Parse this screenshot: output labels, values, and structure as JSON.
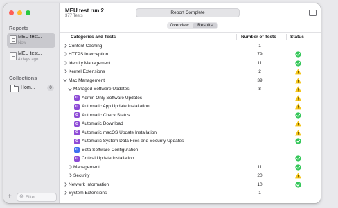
{
  "window": {
    "title": "MEU test run 2",
    "subtitle": "377 Tests",
    "status_pill": "Report Complete"
  },
  "sidebar": {
    "reports_header": "Reports",
    "reports": [
      {
        "name": "MEU test...",
        "sub": "Now",
        "icon": "report-icon",
        "selected": true
      },
      {
        "name": "MEU test...",
        "sub": "4 days ago",
        "icon": "report-icon",
        "selected": false
      }
    ],
    "collections_header": "Collections",
    "collections": [
      {
        "name": "Hom...",
        "count": "0",
        "icon": "folder-icon"
      }
    ],
    "filter_placeholder": "Filter",
    "add_icon": "plus-icon",
    "filter_icon": "filter-icon"
  },
  "tabs": {
    "overview": "Overview",
    "results": "Results",
    "selected": "results"
  },
  "table": {
    "headers": {
      "name": "Categories and Tests",
      "count": "Number of Tests",
      "status": "Status"
    },
    "rows": [
      {
        "label": "Content Caching",
        "count": "1",
        "status": "",
        "level": 0,
        "expandable": true,
        "expanded": false,
        "icon": ""
      },
      {
        "label": "HTTPS Interception",
        "count": "79",
        "status": "pass",
        "level": 0,
        "expandable": true,
        "expanded": false,
        "icon": ""
      },
      {
        "label": "Identity Management",
        "count": "11",
        "status": "pass",
        "level": 0,
        "expandable": true,
        "expanded": false,
        "icon": ""
      },
      {
        "label": "Kernel Extensions",
        "count": "2",
        "status": "warning",
        "level": 0,
        "expandable": true,
        "expanded": false,
        "icon": ""
      },
      {
        "label": "Mac Management",
        "count": "39",
        "status": "warning",
        "level": 0,
        "expandable": true,
        "expanded": true,
        "icon": ""
      },
      {
        "label": "Managed Software Updates",
        "count": "8",
        "status": "warning",
        "level": 1,
        "expandable": true,
        "expanded": true,
        "icon": ""
      },
      {
        "label": "Admin Only Software Updates",
        "count": "",
        "status": "warning",
        "level": 2,
        "expandable": false,
        "expanded": false,
        "icon": "purple"
      },
      {
        "label": "Automatic App Update Installation",
        "count": "",
        "status": "warning",
        "level": 2,
        "expandable": false,
        "expanded": false,
        "icon": "purple"
      },
      {
        "label": "Automatic Check Status",
        "count": "",
        "status": "pass",
        "level": 2,
        "expandable": false,
        "expanded": false,
        "icon": "purple"
      },
      {
        "label": "Automatic Download",
        "count": "",
        "status": "warning",
        "level": 2,
        "expandable": false,
        "expanded": false,
        "icon": "purple"
      },
      {
        "label": "Automatic macOS Update Installation",
        "count": "",
        "status": "warning",
        "level": 2,
        "expandable": false,
        "expanded": false,
        "icon": "purple"
      },
      {
        "label": "Automatic System Data Files and Security Updates",
        "count": "",
        "status": "pass",
        "level": 2,
        "expandable": false,
        "expanded": false,
        "icon": "purple"
      },
      {
        "label": "Beta Software Configuration",
        "count": "",
        "status": "",
        "level": 2,
        "expandable": false,
        "expanded": false,
        "icon": "blue"
      },
      {
        "label": "Critical Update Installation",
        "count": "",
        "status": "pass",
        "level": 2,
        "expandable": false,
        "expanded": false,
        "icon": "purple"
      },
      {
        "label": "Management",
        "count": "11",
        "status": "pass",
        "level": 1,
        "expandable": true,
        "expanded": false,
        "icon": ""
      },
      {
        "label": "Security",
        "count": "20",
        "status": "warning",
        "level": 1,
        "expandable": true,
        "expanded": false,
        "icon": ""
      },
      {
        "label": "Network Information",
        "count": "10",
        "status": "pass",
        "level": 0,
        "expandable": true,
        "expanded": false,
        "icon": ""
      },
      {
        "label": "System Extensions",
        "count": "1",
        "status": "",
        "level": 0,
        "expandable": true,
        "expanded": false,
        "icon": ""
      }
    ]
  },
  "colors": {
    "pass": "#34c759",
    "warning": "#f5c518",
    "test_icon_purple": "#8d4ad6",
    "test_icon_blue": "#3d6ff0"
  }
}
